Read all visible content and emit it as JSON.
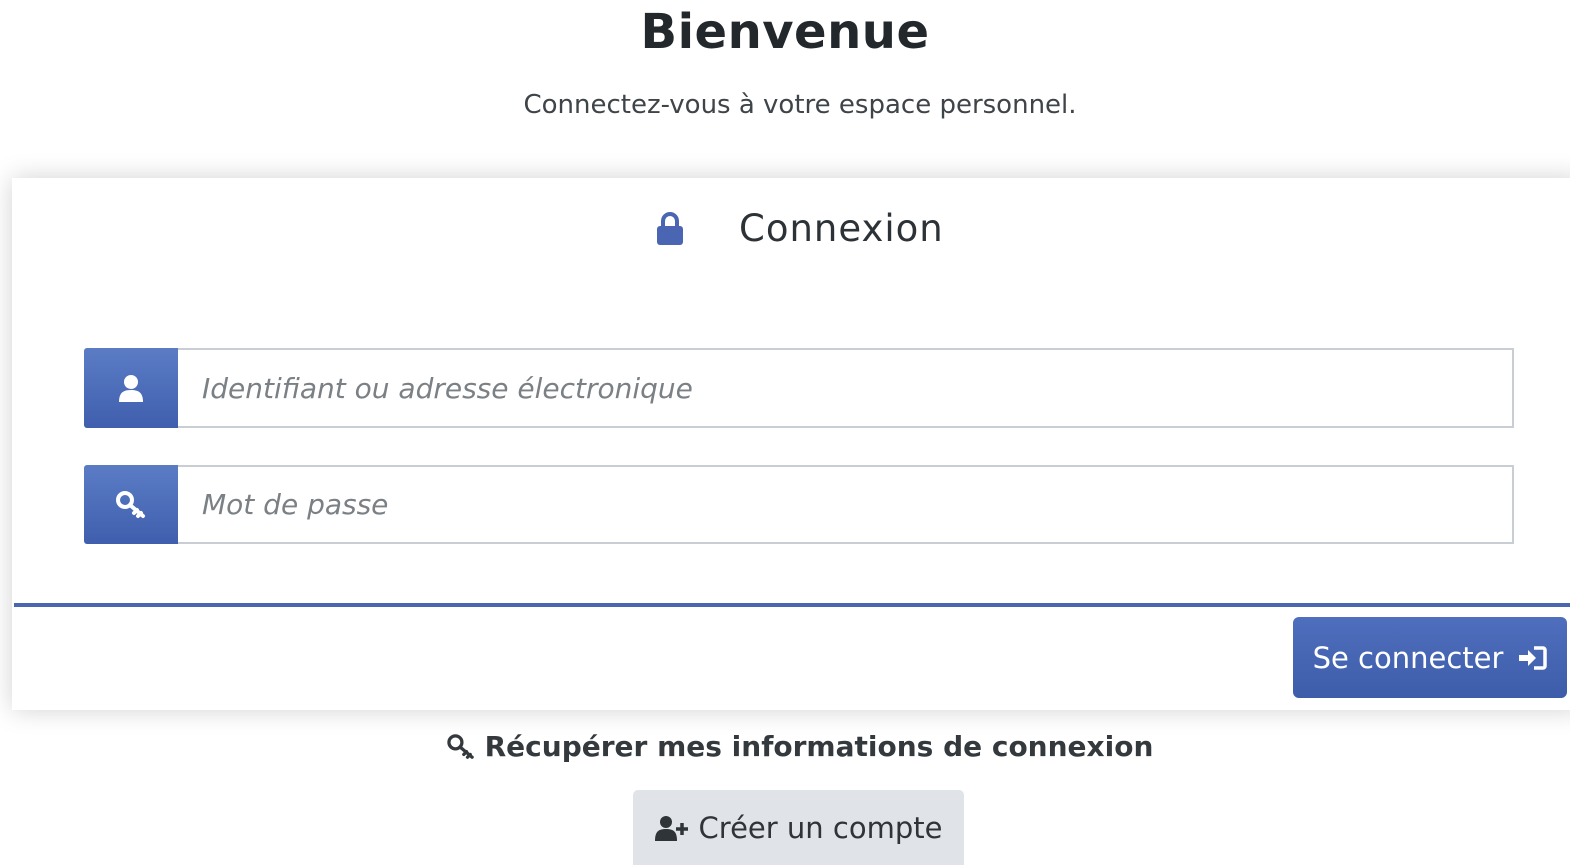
{
  "header": {
    "title": "Bienvenue",
    "subtitle": "Connectez-vous à votre espace personnel."
  },
  "login_card": {
    "title": "Connexion",
    "title_icon": "lock-icon",
    "username_field": {
      "icon": "user-icon",
      "placeholder": "Identifiant ou adresse électronique",
      "value": ""
    },
    "password_field": {
      "icon": "key-icon",
      "placeholder": "Mot de passe",
      "value": ""
    },
    "submit_label": "Se connecter",
    "submit_icon": "sign-in-icon"
  },
  "footer": {
    "recover_label": "Récupérer mes informations de connexion",
    "recover_icon": "key-icon",
    "create_account_label": "Créer un compte",
    "create_account_icon": "user-plus-icon"
  },
  "colors": {
    "accent": "#4a66b3",
    "secondary_button": "#e0e3e7"
  }
}
